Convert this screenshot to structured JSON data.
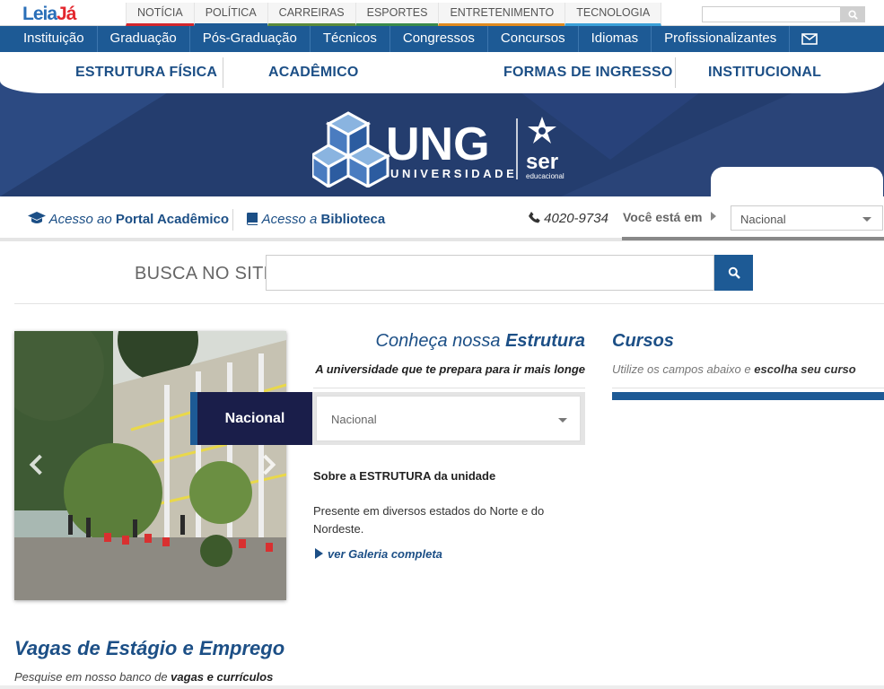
{
  "portal": {
    "logo_a": "Leia",
    "logo_b": "Já",
    "tabs": [
      {
        "label": "NOTÍCIA",
        "color": "#d3262d"
      },
      {
        "label": "POLÍTICA",
        "color": "#1d5a95"
      },
      {
        "label": "CARREIRAS",
        "color": "#5b8a3a"
      },
      {
        "label": "ESPORTES",
        "color": "#3a8a4a"
      },
      {
        "label": "ENTRETENIMENTO",
        "color": "#e08a20"
      },
      {
        "label": "TECNOLOGIA",
        "color": "#3aa0d8"
      }
    ],
    "search_placeholder": ""
  },
  "mainnav": {
    "items": [
      "Instituição",
      "Graduação",
      "Pós-Graduação",
      "Técnicos",
      "Congressos",
      "Concursos",
      "Idiomas",
      "Profissionalizantes"
    ]
  },
  "secnav": {
    "items": [
      "ESTRUTURA FÍSICA",
      "ACADÊMICO",
      "FORMAS DE INGRESSO",
      "INSTITUCIONAL"
    ]
  },
  "brand": {
    "name": "UNG",
    "subtitle": "UNIVERSIDADE",
    "partner": "ser",
    "partner_sub": "educacional"
  },
  "access": {
    "portal_pre": "Acesso ao ",
    "portal_bold": "Portal Acadêmico",
    "biblioteca_pre": "Acesso a ",
    "biblioteca_bold": "Biblioteca",
    "phone": "4020-9734",
    "voce_esta": "Você está em",
    "location": "Nacional"
  },
  "search": {
    "label": "BUSCA NO SITE",
    "placeholder": ""
  },
  "estrutura": {
    "title_pre": "Conheça nossa ",
    "title_bold": "Estrutura",
    "subtitle": "A universidade que te prepara para ir mais longe",
    "unit_label": "Nacional",
    "unit_value": "Nacional",
    "sobre": "Sobre a ESTRUTURA da unidade",
    "text": "Presente em diversos estados do Norte e do Nordeste.",
    "galeria": "ver Galeria completa"
  },
  "cursos": {
    "title": "Cursos",
    "sub_pre": "Utilize os campos abaixo e ",
    "sub_bold": "escolha seu curso"
  },
  "vagas": {
    "title": "Vagas de Estágio e Emprego",
    "sub_pre": "Pesquise em nosso banco de ",
    "sub_bold": "vagas e currículos"
  }
}
